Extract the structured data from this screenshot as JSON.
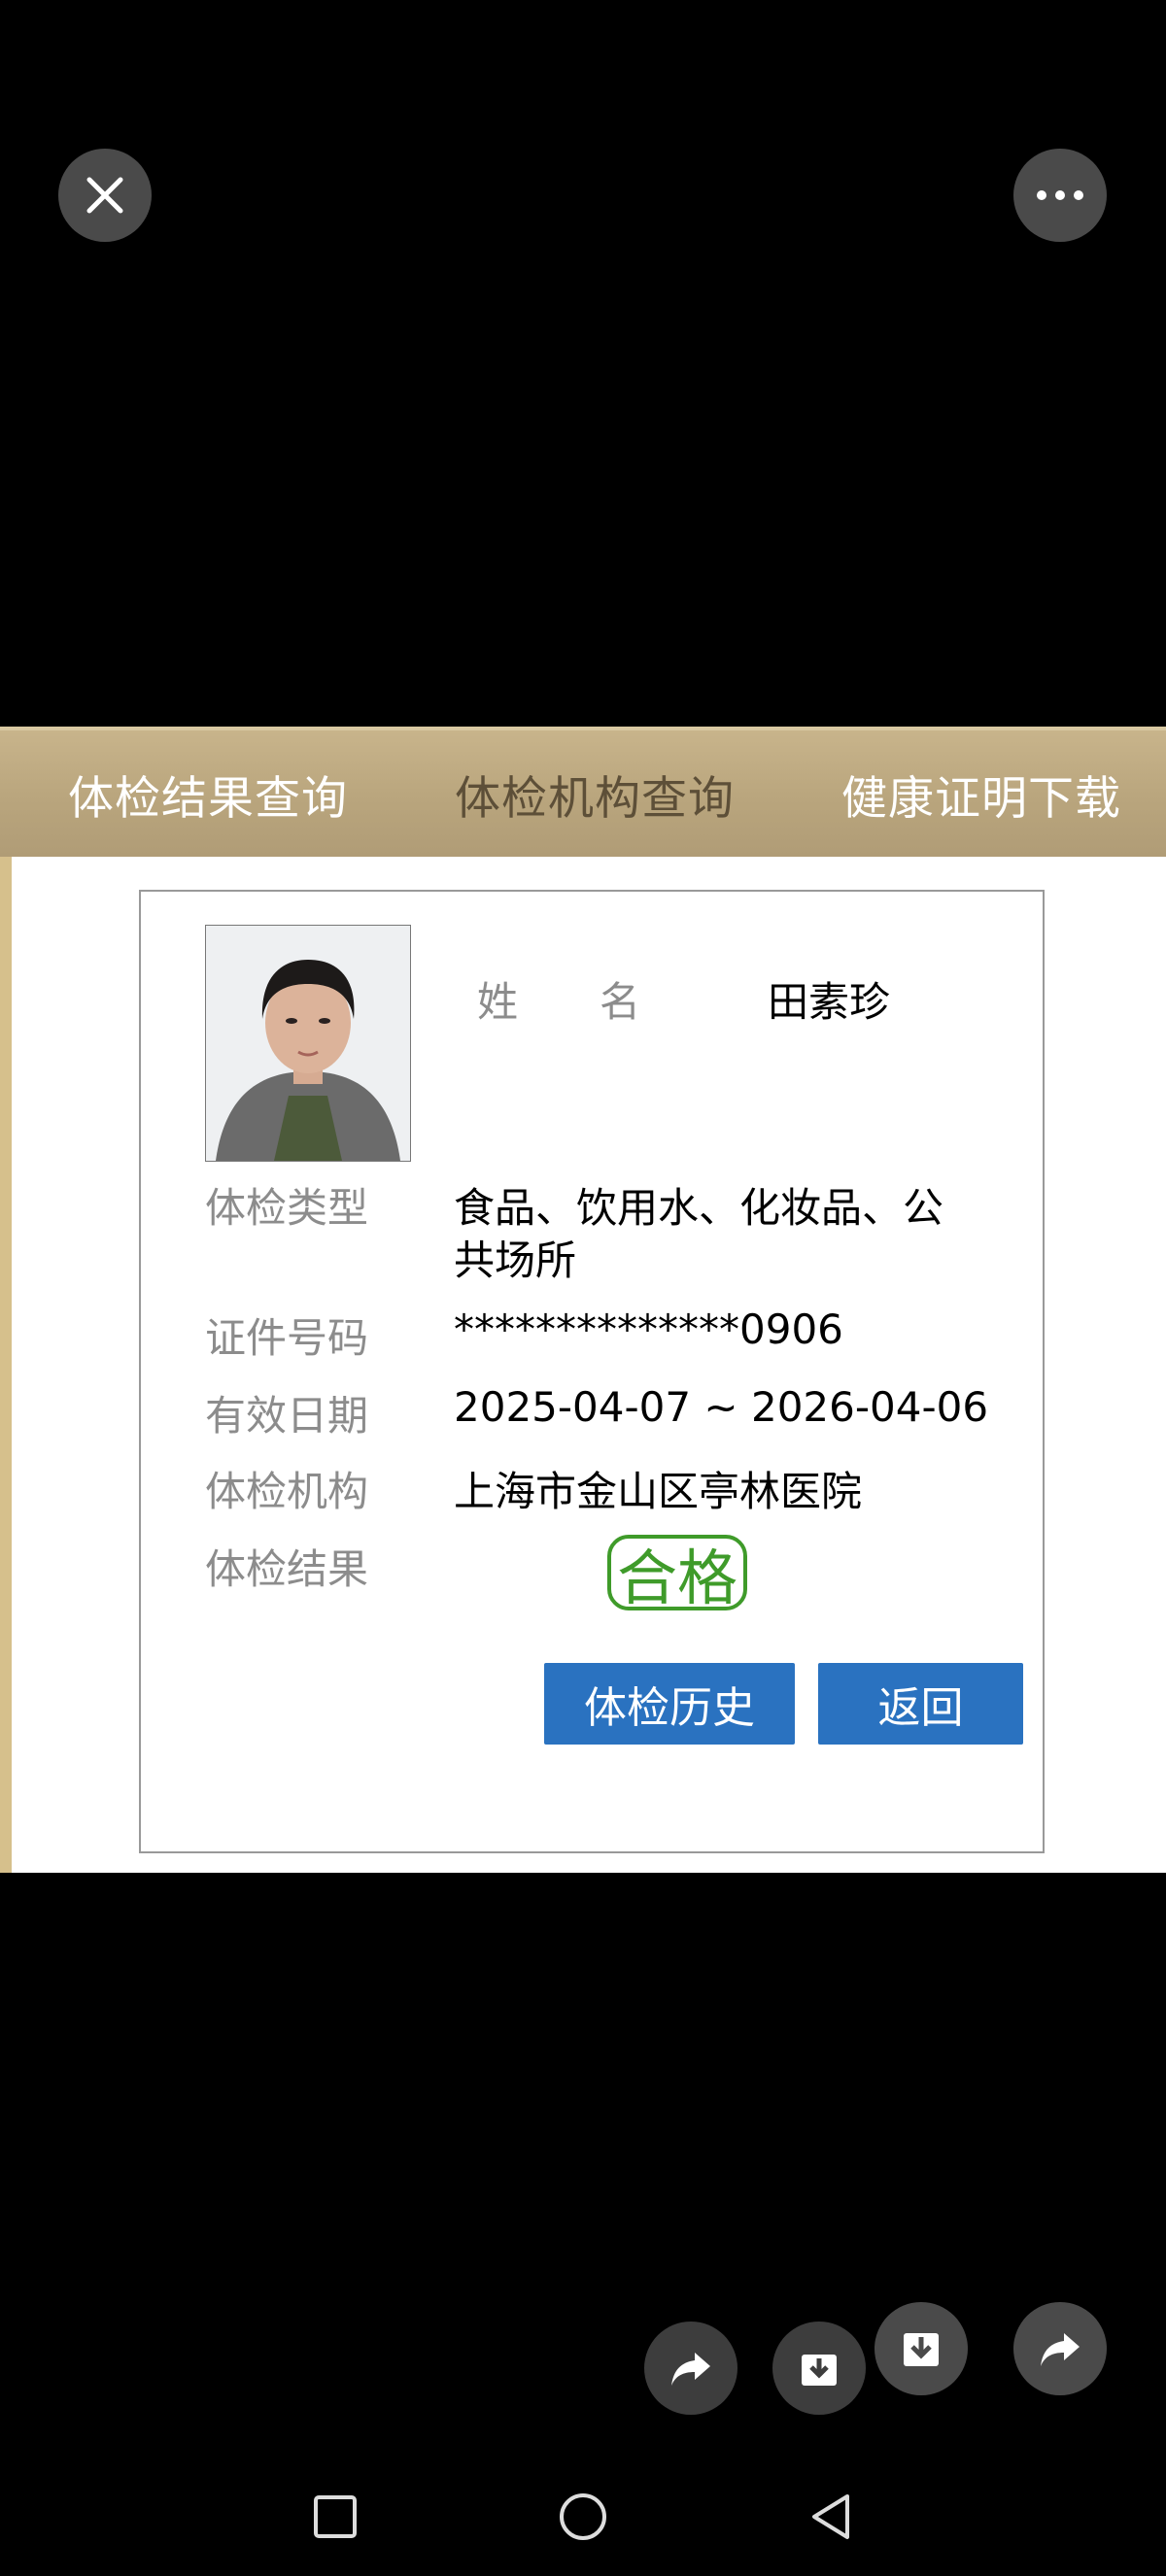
{
  "topbar": {
    "close_icon": "close-icon",
    "more_icon": "more-dots-icon"
  },
  "tabs": [
    {
      "label": "体检结果查询",
      "active": false
    },
    {
      "label": "体检机构查询",
      "active": true
    },
    {
      "label": "健康证明下载",
      "active": false
    }
  ],
  "card": {
    "name_label": "姓　　名",
    "name_value": "田素珍",
    "type_label": "体检类型",
    "type_value_line1": "食品、饮用水、化妆品、公",
    "type_value_line2": "共场所",
    "id_label": "证件号码",
    "id_value": "**************0906",
    "validity_label": "有效日期",
    "validity_value": "2025-04-07 ~ 2026-04-06",
    "org_label": "体检机构",
    "org_value": "上海市金山区亭林医院",
    "result_label": "体检结果",
    "result_badge": "合格",
    "history_button": "体检历史",
    "back_button": "返回"
  },
  "colors": {
    "tab_bar": "#b9a57d",
    "button_blue": "#2a72c0",
    "pass_green": "#3f9b2a"
  },
  "floating_actions": [
    "share-icon",
    "download-icon",
    "save-icon",
    "forward-icon"
  ],
  "system_nav": [
    "recent-apps-icon",
    "home-icon",
    "back-icon"
  ]
}
